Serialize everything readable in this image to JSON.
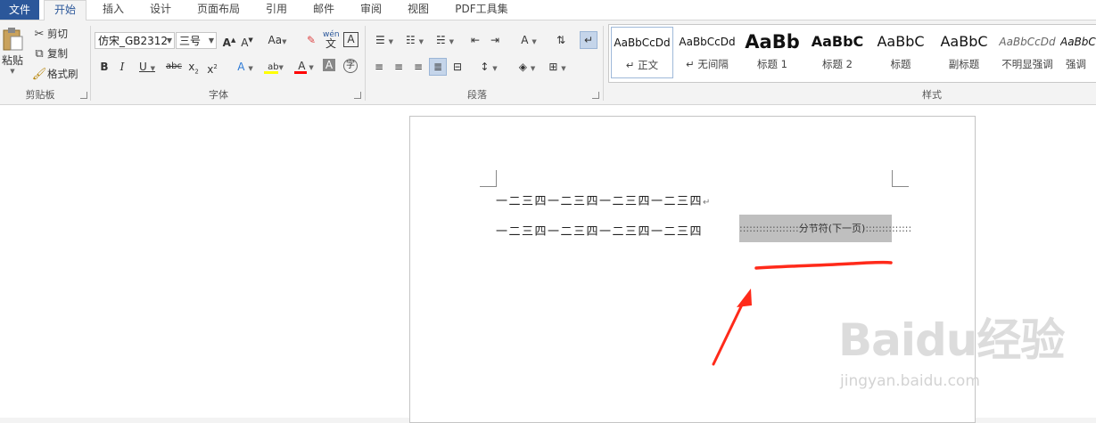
{
  "tabs": {
    "file": "文件",
    "items": [
      "开始",
      "插入",
      "设计",
      "页面布局",
      "引用",
      "邮件",
      "审阅",
      "视图",
      "PDF工具集"
    ]
  },
  "clipboard": {
    "paste": "粘贴",
    "cut": "剪切",
    "copy": "复制",
    "format_painter": "格式刷",
    "group_label": "剪贴板"
  },
  "font": {
    "family": "仿宋_GB2312",
    "size": "三号",
    "group_label": "字体",
    "phonetic": "wén",
    "change_case": "Aa",
    "font_color": "#ff0000",
    "highlight_color": "#ffff00"
  },
  "paragraph": {
    "group_label": "段落"
  },
  "styles": {
    "group_label": "样式",
    "items": [
      {
        "sample": "AaBbCcDd",
        "name": "↵ 正文"
      },
      {
        "sample": "AaBbCcDd",
        "name": "↵ 无间隔"
      },
      {
        "sample": "AaBb",
        "name": "标题 1"
      },
      {
        "sample": "AaBbC",
        "name": "标题 2"
      },
      {
        "sample": "AaBbC",
        "name": "标题"
      },
      {
        "sample": "AaBbC",
        "name": "副标题"
      },
      {
        "sample": "AaBbCcDd",
        "name": "不明显强调"
      },
      {
        "sample": "AaBbCcDd",
        "name": "强调"
      }
    ]
  },
  "document": {
    "line1": "一二三四一二三四一二三四一二三四",
    "line1_mark": "↵",
    "line2": "一二三四一二三四一二三四一二三四",
    "section_break_label": "分节符(下一页)"
  },
  "annotation": {
    "color": "#ff2a1a"
  },
  "watermark": {
    "logo": "Baidu经验",
    "url": "jingyan.baidu.com"
  }
}
